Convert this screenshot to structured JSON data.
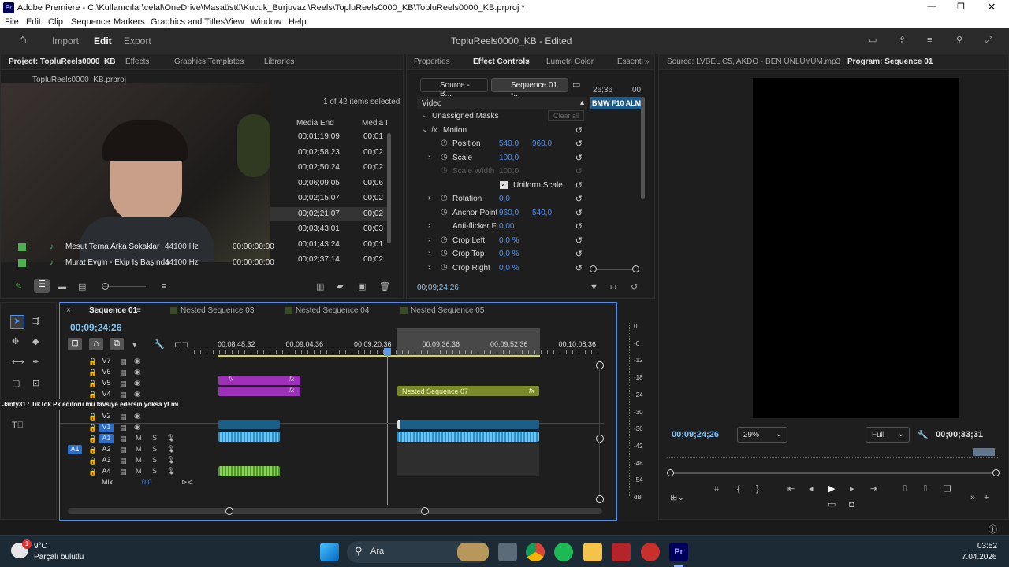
{
  "titlebar": {
    "title": "Adobe Premiere - C:\\Kullanıcılar\\celal\\OneDrive\\Masaüstü\\Kucuk_Burjuvazi\\Reels\\TopluReels0000_KB\\TopluReels0000_KB.prproj *"
  },
  "menu": [
    "File",
    "Edit",
    "Clip",
    "Sequence",
    "Markers",
    "Graphics and Titles",
    "View",
    "Window",
    "Help"
  ],
  "appbar": {
    "import": "Import",
    "edit": "Edit",
    "export": "Export",
    "project_title": "TopluReels0000_KB - Edited"
  },
  "project_panel": {
    "tabs": [
      "Project: TopluReels0000_KB",
      "Effects",
      "Graphics Templates",
      "Libraries"
    ],
    "file": "TopluReels0000_KB.prproj",
    "count": "1 of 42 items selected",
    "col_media_end": "Media End",
    "col_media_d": "Media I",
    "end_values": [
      "00;01;19;09",
      "00;02;58;23",
      "00;02;50;24",
      "00;06;09;05",
      "00;02;15;07",
      "00;02;21;07",
      "00;03;43;01",
      "00;01;43;24",
      "00;02;37;14"
    ],
    "d_values": [
      "00;01",
      "00;02",
      "00;02",
      "00;06",
      "00;02",
      "00;02",
      "00;03",
      "00;01",
      "00;02"
    ],
    "items": [
      {
        "name": "Mesut Terna  Arka Sokaklar",
        "rate": "44100 Hz",
        "start": "00:00:00:00"
      },
      {
        "name": "Murat Evgin - Ekip İş Başında",
        "rate": "44100 Hz",
        "start": "00:00:00:00"
      }
    ]
  },
  "effect_controls": {
    "tabs": [
      "Properties",
      "Effect Controls",
      "Lumetri Color",
      "Essenti"
    ],
    "source_btn": "Source - B...",
    "seq_btn": "Sequence 01 -...",
    "ruler_time": "26;36",
    "ruler_time2": "00",
    "clip_label": "BMW F10 ALM",
    "video": "Video",
    "masks": "Unassigned Masks",
    "clear_all": "Clear all",
    "motion": "Motion",
    "props": [
      {
        "name": "Position",
        "v1": "540,0",
        "v2": "960,0"
      },
      {
        "name": "Scale",
        "v1": "100,0",
        "v2": ""
      },
      {
        "name": "Scale Width",
        "v1": "100,0",
        "v2": ""
      },
      {
        "name": "Uniform Scale",
        "v1": "",
        "v2": ""
      },
      {
        "name": "Rotation",
        "v1": "0,0",
        "v2": ""
      },
      {
        "name": "Anchor Point",
        "v1": "960,0",
        "v2": "540,0"
      },
      {
        "name": "Anti-flicker Fi...",
        "v1": "0,00",
        "v2": ""
      },
      {
        "name": "Crop Left",
        "v1": "0,0 %",
        "v2": ""
      },
      {
        "name": "Crop Top",
        "v1": "0,0 %",
        "v2": ""
      },
      {
        "name": "Crop Right",
        "v1": "0,0 %",
        "v2": ""
      }
    ],
    "timecode": "00;09;24;26"
  },
  "program": {
    "source_tab": "Source: LVBEL C5, AKDO - BEN ÜNLÜYÜM.mp3",
    "program_tab": "Program: Sequence 01",
    "timecode": "00;09;24;26",
    "zoom": "29%",
    "quality": "Full",
    "duration": "00;00;33;31"
  },
  "timeline": {
    "tabs": [
      "Sequence 01",
      "Nested Sequence 03",
      "Nested Sequence 04",
      "Nested Sequence 05"
    ],
    "timecode": "00;09;24;26",
    "ruler": [
      "00;08;48;32",
      "00;09;04;36",
      "00;09;20;36",
      "00;09;36;36",
      "00;09;52;36",
      "00;10;08;36"
    ],
    "tracks": [
      "V7",
      "V6",
      "V5",
      "V4",
      "V3",
      "V2",
      "V1",
      "A1",
      "A2",
      "A3",
      "A4",
      "Mix"
    ],
    "mix_val": "0,0",
    "nested_clip": "Nested Sequence 07",
    "a1_patch": "A1",
    "meter": [
      "0",
      "-6",
      "-12",
      "-18",
      "-24",
      "-30",
      "-36",
      "-42",
      "-48",
      "-54",
      "dB"
    ]
  },
  "chat_overlay": "Janty31 : TikTok Pk editörü mü tavsiye edersin yoksa yt mi",
  "taskbar": {
    "temp": "9°C",
    "weather": "Parçalı bulutlu",
    "search": "Ara",
    "time": "03:52",
    "date": "7.04.2026",
    "badge": "1"
  }
}
